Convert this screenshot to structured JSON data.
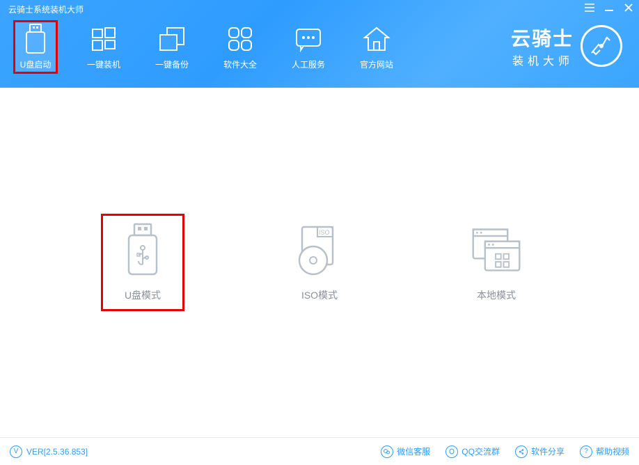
{
  "app": {
    "title": "云骑士系统装机大师"
  },
  "nav": {
    "items": [
      {
        "label": "U盘启动"
      },
      {
        "label": "一键装机"
      },
      {
        "label": "一键备份"
      },
      {
        "label": "软件大全"
      },
      {
        "label": "人工服务"
      },
      {
        "label": "官方网站"
      }
    ]
  },
  "brand": {
    "line1": "云骑士",
    "line2": "装机大师"
  },
  "modes": [
    {
      "label": "U盘模式"
    },
    {
      "label": "ISO模式"
    },
    {
      "label": "本地模式"
    }
  ],
  "footer": {
    "version": "VER[2.5.36.853]",
    "links": [
      {
        "label": "微信客服"
      },
      {
        "label": "QQ交流群"
      },
      {
        "label": "软件分享"
      },
      {
        "label": "帮助视频"
      }
    ]
  }
}
